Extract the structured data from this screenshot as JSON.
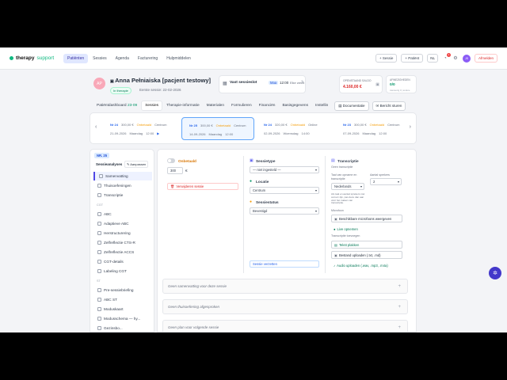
{
  "app": {
    "logo": "therapy",
    "logo_suffix": "support"
  },
  "nav": {
    "items": [
      "Patiënten",
      "Sessies",
      "Agenda",
      "Facturering",
      "Hulpmiddelen"
    ],
    "session_btn": "+ Sessie",
    "patient_btn": "+ Patiënt",
    "lang": "NL",
    "notif_count": "1",
    "user_initials": "JS",
    "logout": "Afmelden"
  },
  "patient": {
    "initials": "AP",
    "name": "Anna Pełniaiska [pacjent testowy]",
    "status": "In therapie",
    "first_session": "Eerste sessie: 22-02-2026",
    "slot_title": "Vast sessieslot",
    "slot_day": "Maa",
    "slot_time": "12:00",
    "slot_freq": "Elke week",
    "balance_label": "OPENSTAAND SALDO",
    "balance_value": "4.160,00 €",
    "consent_label": "AFWEZIGHEDEN",
    "consent_value": "0/0",
    "consent_sub": "Aanwezig 0 | andere"
  },
  "tabs": {
    "items": [
      "Patiëntdashboard",
      "Sessies",
      "Therapie-informatie",
      "Materialen",
      "Formulieren",
      "Financiën",
      "Basisgegevens",
      "Instellin"
    ],
    "dashboard_date": "23-09",
    "documents_btn": "Documentatie",
    "email_btn": "Bericht sturen"
  },
  "sessions": [
    {
      "nr": "Nr 24",
      "price": "300,00 €",
      "status": "Onbetaald",
      "loc": "Centrum",
      "date": "21-09-2026",
      "day": "Maandag",
      "time": "12:00"
    },
    {
      "nr": "Nr 25",
      "price": "300,00 €",
      "status": "Onbetaald",
      "loc": "Centrum",
      "date": "14-09-2026",
      "day": "Maandag",
      "time": "12:00"
    },
    {
      "nr": "Nr 24",
      "price": "320,00 €",
      "status": "Onbetaald",
      "loc": "Online",
      "date": "02-09-2026",
      "day": "Woensdag",
      "time": "14:00"
    },
    {
      "nr": "Nr 23",
      "price": "300,00 €",
      "status": "Onbetaald",
      "loc": "Centrum",
      "date": "07-09-2026",
      "day": "Maandag",
      "time": "12:00"
    }
  ],
  "sidebar": {
    "nr": "NR. 25",
    "title": "Sessieanalyses",
    "adjust_btn": "Aanpassen",
    "items_top": [
      "Samenvatting",
      "Thuisoefeningen",
      "Transcriptie"
    ],
    "group1": "CGT",
    "items_cgt": [
      "ABC",
      "Adaptieve ABC",
      "Herstructurering",
      "Zelfreflectie CTS-R",
      "Zelfreflectie ACCS",
      "CGT-details",
      "Labeling CGT"
    ],
    "group2": "ST",
    "items_st": [
      "Pre-sessiebriefing",
      "ABC ST",
      "Moduskaart",
      "Modusschema — hy...",
      "Gezinsbo..."
    ]
  },
  "form": {
    "unpaid_label": "Onbetaald",
    "price_value": "300",
    "currency": "€",
    "delete_btn": "Verwijderen sessie",
    "type_label": "Sessietype",
    "type_value": "— niet ingesteld —",
    "location_label": "Locatie",
    "location_value": "Centrum",
    "status_label": "Sessiestatus",
    "status_value": "Bevestigd",
    "move_btn": "Sessie verzetten",
    "transcript_label": "Transcriptie",
    "transcript_empty": "Geen transcriptie",
    "lang_label": "Taal van opname en transcriptie",
    "lang_value": "Nederlands",
    "speakers_label": "Aantal sprekers",
    "speakers_value": "2",
    "hint": "Als taal en aantal sprekers niet correct zijn, pas deze dan aan vóór het maken van transcriptie.",
    "mic_label": "Microfoon",
    "mic_btn": "Beschikbare microfoons weergeven",
    "live_btn": "Live opnemen",
    "add_label": "Transcriptie toevoegen",
    "paste_btn": "Tekst plakken",
    "upload_btn": "Bestand uploaden (.txt, .md)",
    "audio_btn": "Audio uploaden (.wav, .mp3, .m4a)"
  },
  "panels": [
    "Geen samenvatting voor deze sessie",
    "Geen thuisoefening afgesproken",
    "Geen plan voor volgende sessie"
  ]
}
